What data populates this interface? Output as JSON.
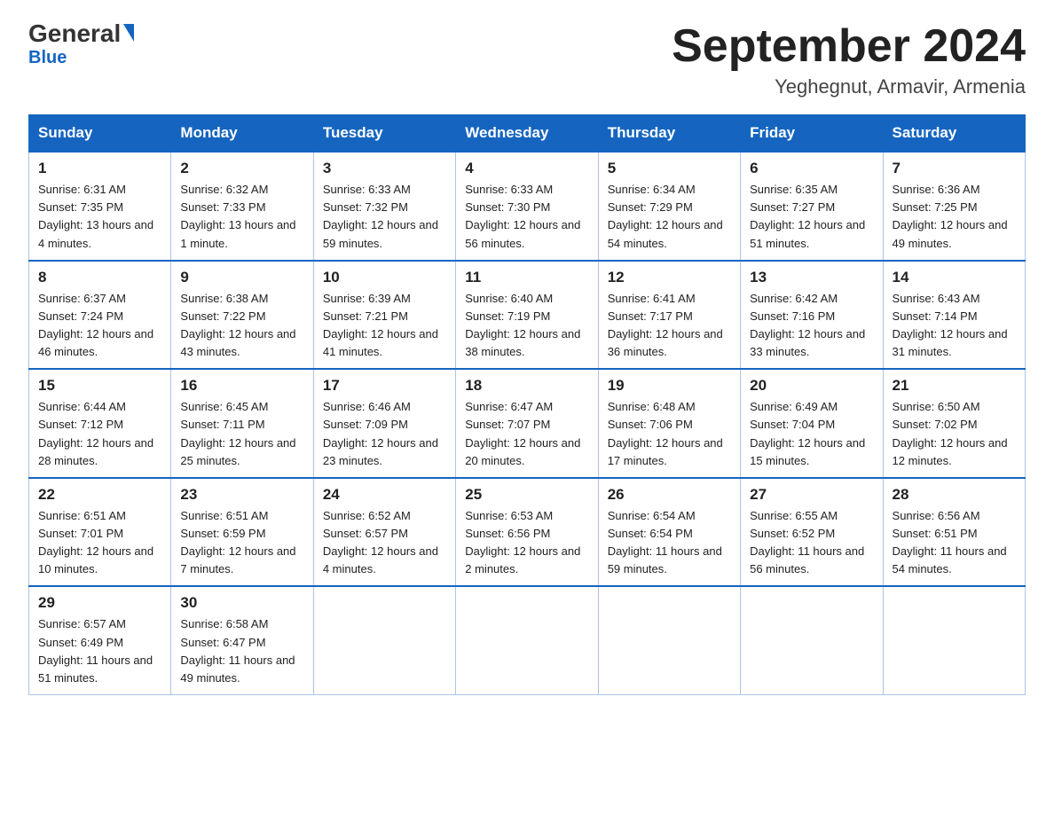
{
  "logo": {
    "text_general": "General",
    "text_blue": "Blue",
    "subtitle": "Blue"
  },
  "header": {
    "title": "September 2024",
    "subtitle": "Yeghegnut, Armavir, Armenia"
  },
  "weekdays": [
    "Sunday",
    "Monday",
    "Tuesday",
    "Wednesday",
    "Thursday",
    "Friday",
    "Saturday"
  ],
  "weeks": [
    [
      {
        "day": "1",
        "sunrise": "Sunrise: 6:31 AM",
        "sunset": "Sunset: 7:35 PM",
        "daylight": "Daylight: 13 hours and 4 minutes."
      },
      {
        "day": "2",
        "sunrise": "Sunrise: 6:32 AM",
        "sunset": "Sunset: 7:33 PM",
        "daylight": "Daylight: 13 hours and 1 minute."
      },
      {
        "day": "3",
        "sunrise": "Sunrise: 6:33 AM",
        "sunset": "Sunset: 7:32 PM",
        "daylight": "Daylight: 12 hours and 59 minutes."
      },
      {
        "day": "4",
        "sunrise": "Sunrise: 6:33 AM",
        "sunset": "Sunset: 7:30 PM",
        "daylight": "Daylight: 12 hours and 56 minutes."
      },
      {
        "day": "5",
        "sunrise": "Sunrise: 6:34 AM",
        "sunset": "Sunset: 7:29 PM",
        "daylight": "Daylight: 12 hours and 54 minutes."
      },
      {
        "day": "6",
        "sunrise": "Sunrise: 6:35 AM",
        "sunset": "Sunset: 7:27 PM",
        "daylight": "Daylight: 12 hours and 51 minutes."
      },
      {
        "day": "7",
        "sunrise": "Sunrise: 6:36 AM",
        "sunset": "Sunset: 7:25 PM",
        "daylight": "Daylight: 12 hours and 49 minutes."
      }
    ],
    [
      {
        "day": "8",
        "sunrise": "Sunrise: 6:37 AM",
        "sunset": "Sunset: 7:24 PM",
        "daylight": "Daylight: 12 hours and 46 minutes."
      },
      {
        "day": "9",
        "sunrise": "Sunrise: 6:38 AM",
        "sunset": "Sunset: 7:22 PM",
        "daylight": "Daylight: 12 hours and 43 minutes."
      },
      {
        "day": "10",
        "sunrise": "Sunrise: 6:39 AM",
        "sunset": "Sunset: 7:21 PM",
        "daylight": "Daylight: 12 hours and 41 minutes."
      },
      {
        "day": "11",
        "sunrise": "Sunrise: 6:40 AM",
        "sunset": "Sunset: 7:19 PM",
        "daylight": "Daylight: 12 hours and 38 minutes."
      },
      {
        "day": "12",
        "sunrise": "Sunrise: 6:41 AM",
        "sunset": "Sunset: 7:17 PM",
        "daylight": "Daylight: 12 hours and 36 minutes."
      },
      {
        "day": "13",
        "sunrise": "Sunrise: 6:42 AM",
        "sunset": "Sunset: 7:16 PM",
        "daylight": "Daylight: 12 hours and 33 minutes."
      },
      {
        "day": "14",
        "sunrise": "Sunrise: 6:43 AM",
        "sunset": "Sunset: 7:14 PM",
        "daylight": "Daylight: 12 hours and 31 minutes."
      }
    ],
    [
      {
        "day": "15",
        "sunrise": "Sunrise: 6:44 AM",
        "sunset": "Sunset: 7:12 PM",
        "daylight": "Daylight: 12 hours and 28 minutes."
      },
      {
        "day": "16",
        "sunrise": "Sunrise: 6:45 AM",
        "sunset": "Sunset: 7:11 PM",
        "daylight": "Daylight: 12 hours and 25 minutes."
      },
      {
        "day": "17",
        "sunrise": "Sunrise: 6:46 AM",
        "sunset": "Sunset: 7:09 PM",
        "daylight": "Daylight: 12 hours and 23 minutes."
      },
      {
        "day": "18",
        "sunrise": "Sunrise: 6:47 AM",
        "sunset": "Sunset: 7:07 PM",
        "daylight": "Daylight: 12 hours and 20 minutes."
      },
      {
        "day": "19",
        "sunrise": "Sunrise: 6:48 AM",
        "sunset": "Sunset: 7:06 PM",
        "daylight": "Daylight: 12 hours and 17 minutes."
      },
      {
        "day": "20",
        "sunrise": "Sunrise: 6:49 AM",
        "sunset": "Sunset: 7:04 PM",
        "daylight": "Daylight: 12 hours and 15 minutes."
      },
      {
        "day": "21",
        "sunrise": "Sunrise: 6:50 AM",
        "sunset": "Sunset: 7:02 PM",
        "daylight": "Daylight: 12 hours and 12 minutes."
      }
    ],
    [
      {
        "day": "22",
        "sunrise": "Sunrise: 6:51 AM",
        "sunset": "Sunset: 7:01 PM",
        "daylight": "Daylight: 12 hours and 10 minutes."
      },
      {
        "day": "23",
        "sunrise": "Sunrise: 6:51 AM",
        "sunset": "Sunset: 6:59 PM",
        "daylight": "Daylight: 12 hours and 7 minutes."
      },
      {
        "day": "24",
        "sunrise": "Sunrise: 6:52 AM",
        "sunset": "Sunset: 6:57 PM",
        "daylight": "Daylight: 12 hours and 4 minutes."
      },
      {
        "day": "25",
        "sunrise": "Sunrise: 6:53 AM",
        "sunset": "Sunset: 6:56 PM",
        "daylight": "Daylight: 12 hours and 2 minutes."
      },
      {
        "day": "26",
        "sunrise": "Sunrise: 6:54 AM",
        "sunset": "Sunset: 6:54 PM",
        "daylight": "Daylight: 11 hours and 59 minutes."
      },
      {
        "day": "27",
        "sunrise": "Sunrise: 6:55 AM",
        "sunset": "Sunset: 6:52 PM",
        "daylight": "Daylight: 11 hours and 56 minutes."
      },
      {
        "day": "28",
        "sunrise": "Sunrise: 6:56 AM",
        "sunset": "Sunset: 6:51 PM",
        "daylight": "Daylight: 11 hours and 54 minutes."
      }
    ],
    [
      {
        "day": "29",
        "sunrise": "Sunrise: 6:57 AM",
        "sunset": "Sunset: 6:49 PM",
        "daylight": "Daylight: 11 hours and 51 minutes."
      },
      {
        "day": "30",
        "sunrise": "Sunrise: 6:58 AM",
        "sunset": "Sunset: 6:47 PM",
        "daylight": "Daylight: 11 hours and 49 minutes."
      },
      null,
      null,
      null,
      null,
      null
    ]
  ]
}
